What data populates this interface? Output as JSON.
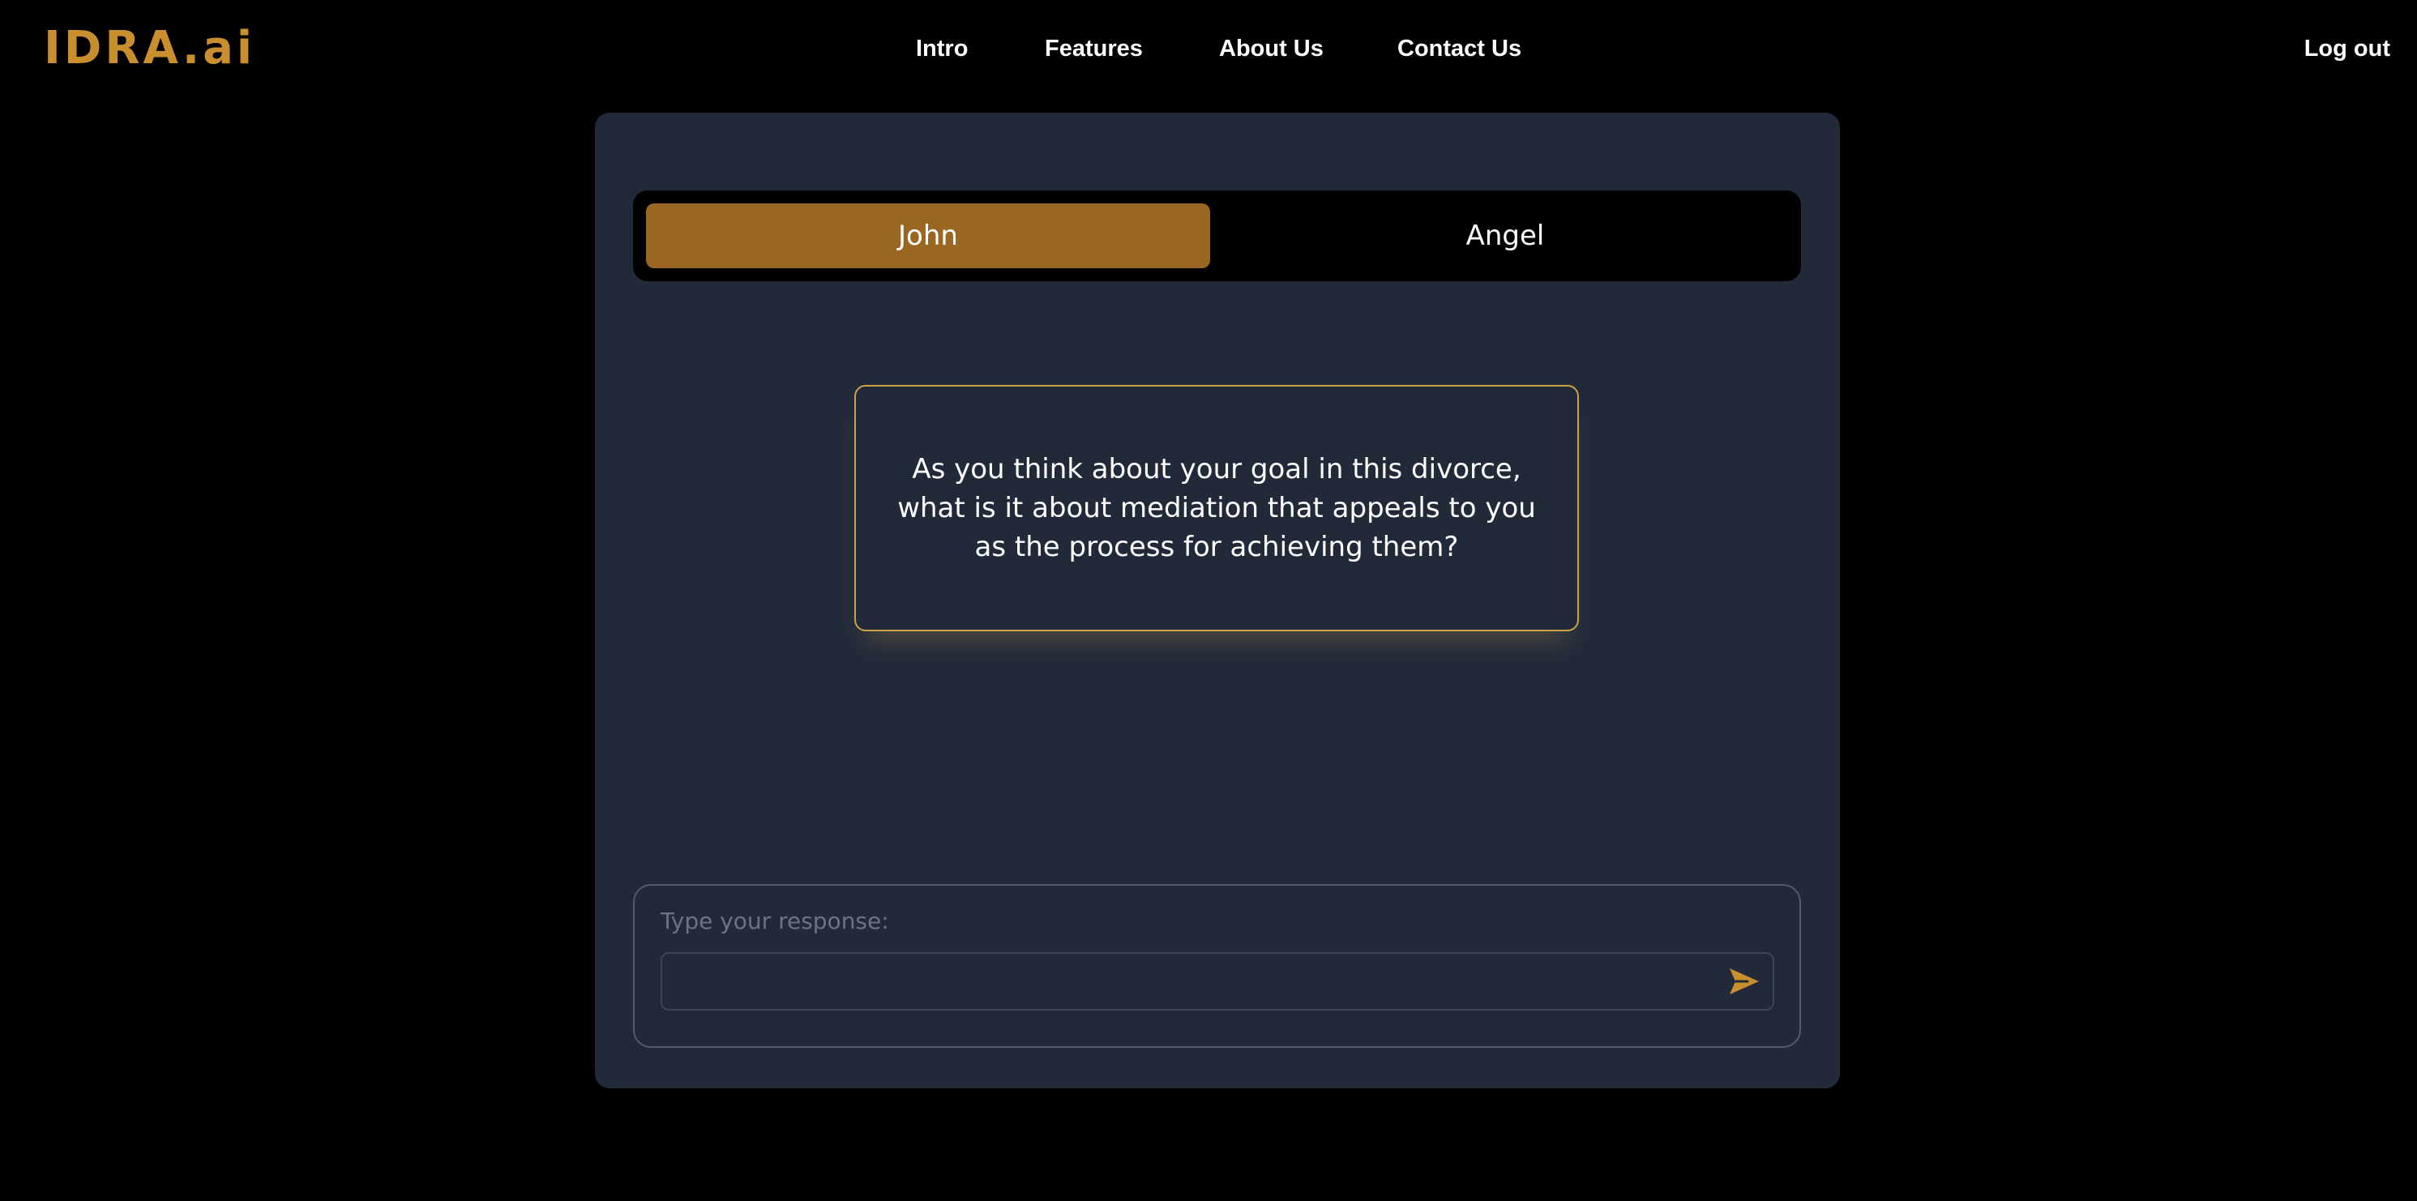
{
  "header": {
    "logo": "IDRA.ai",
    "nav": {
      "intro": "Intro",
      "features": "Features",
      "about": "About Us",
      "contact": "Contact Us"
    },
    "logout": "Log out"
  },
  "tabs": {
    "active": "John",
    "items": [
      "John",
      "Angel"
    ]
  },
  "question": {
    "text": "As you think about your goal in this divorce, what is it about mediation that appeals to you as the process for achieving them?"
  },
  "response": {
    "label": "Type your response:",
    "value": ""
  },
  "icons": {
    "send": "send-icon"
  },
  "colors": {
    "accent": "#c98f2e",
    "active_tab": "#9a6723",
    "panel": "#222a3a",
    "background": "#000000",
    "card_border": "#c9a24a"
  }
}
